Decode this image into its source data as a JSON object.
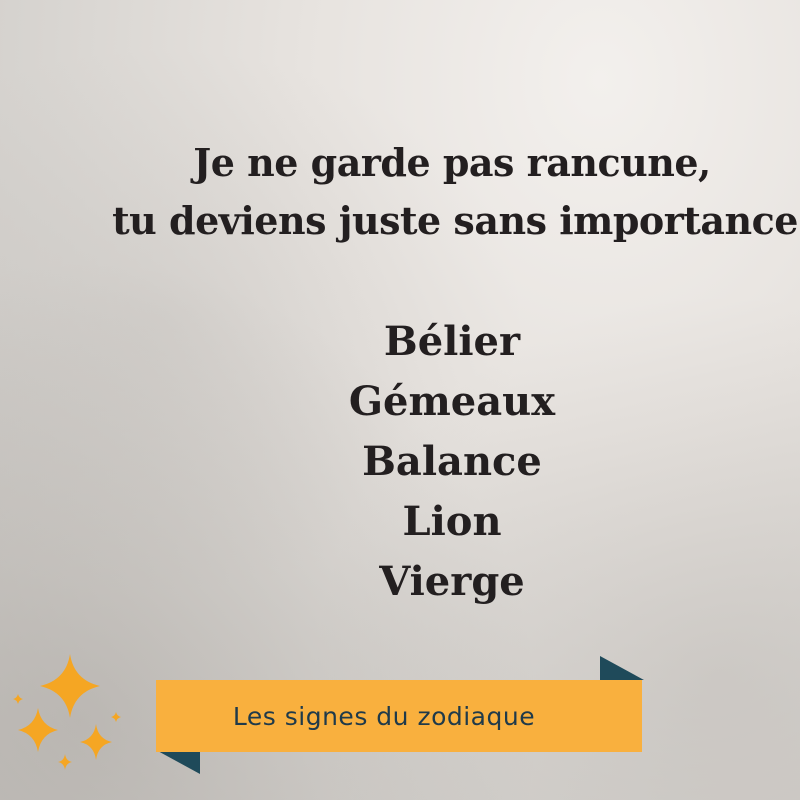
{
  "quote": {
    "line1": "Je ne garde pas rancune,",
    "line2": "tu deviens juste sans importance"
  },
  "signs": [
    "Bélier",
    "Gémeaux",
    "Balance",
    "Lion",
    "Vierge"
  ],
  "banner": {
    "text": "Les signes du zodiaque",
    "color": "#f9b03e",
    "text_color": "#1f3a4a",
    "fold_color": "#1f4a5a"
  },
  "decoration": {
    "icon": "sparkles-icon",
    "color": "#f5a623"
  }
}
